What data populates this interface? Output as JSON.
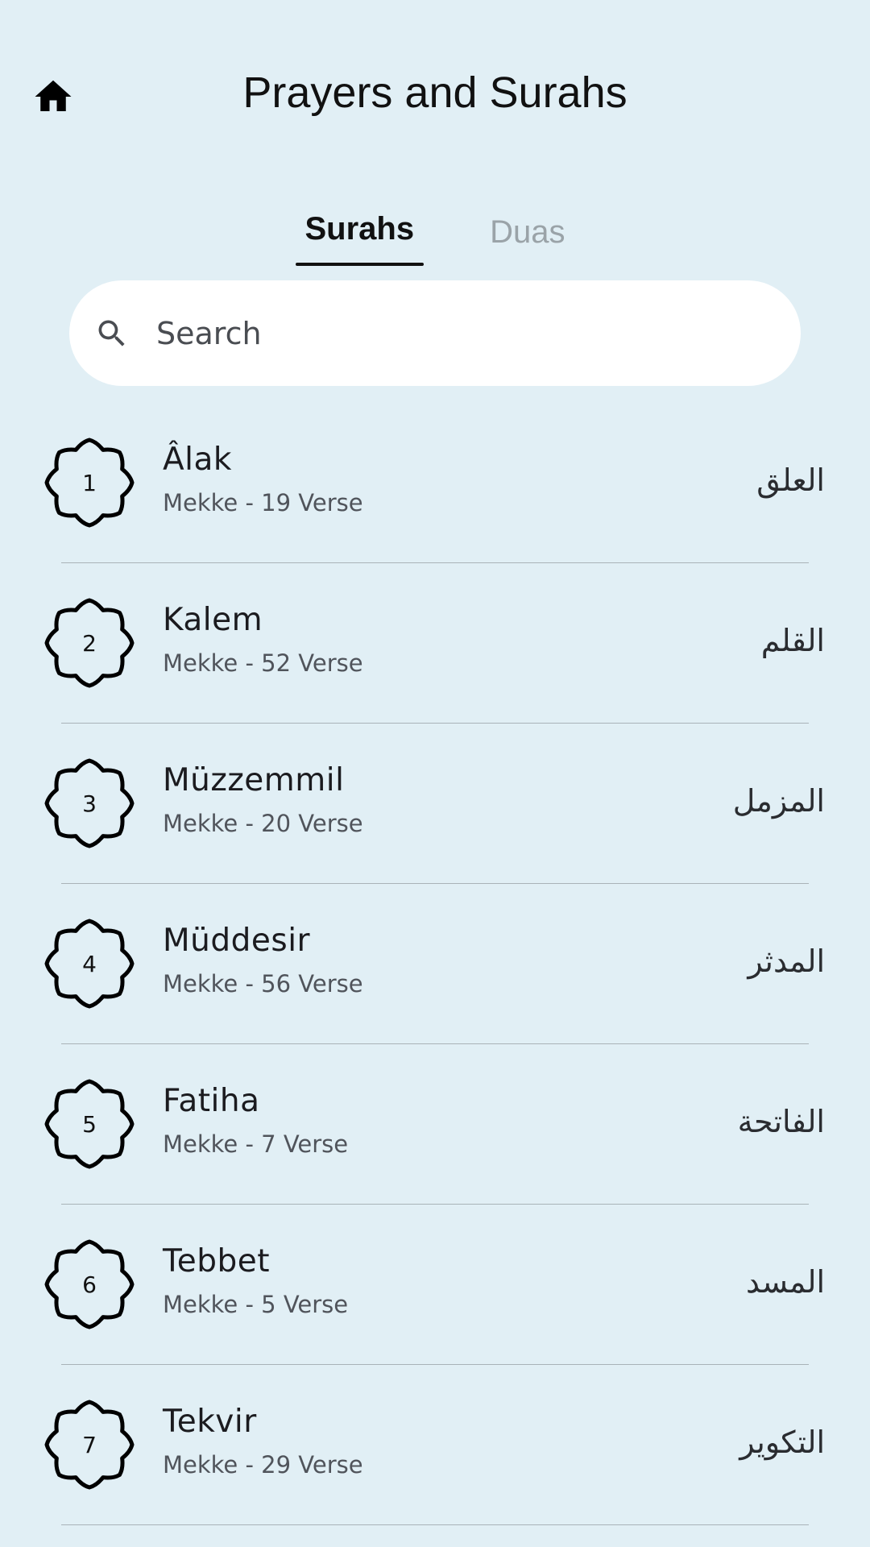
{
  "header": {
    "title": "Prayers and Surahs",
    "home_icon": "home-icon"
  },
  "tabs": [
    {
      "label": "Surahs",
      "active": true
    },
    {
      "label": "Duas",
      "active": false
    }
  ],
  "search": {
    "placeholder": "Search",
    "value": "",
    "icon": "search-icon"
  },
  "surahs": [
    {
      "number": "1",
      "name": "Âlak",
      "meta": "Mekke - 19 Verse",
      "arabic": "العلق"
    },
    {
      "number": "2",
      "name": "Kalem",
      "meta": "Mekke - 52 Verse",
      "arabic": "القلم"
    },
    {
      "number": "3",
      "name": "Müzzemmil",
      "meta": "Mekke - 20 Verse",
      "arabic": "المزمل"
    },
    {
      "number": "4",
      "name": "Müddesir",
      "meta": "Mekke - 56 Verse",
      "arabic": "المدثر"
    },
    {
      "number": "5",
      "name": "Fatiha",
      "meta": "Mekke - 7 Verse",
      "arabic": "الفاتحة"
    },
    {
      "number": "6",
      "name": "Tebbet",
      "meta": "Mekke - 5 Verse",
      "arabic": "المسد"
    },
    {
      "number": "7",
      "name": "Tekvir",
      "meta": "Mekke - 29 Verse",
      "arabic": "التكوير"
    }
  ],
  "colors": {
    "background": "#e1eff5",
    "search_bg": "#ffffff",
    "inactive_tab": "#9aa3a8",
    "divider": "#a9b3b8"
  }
}
